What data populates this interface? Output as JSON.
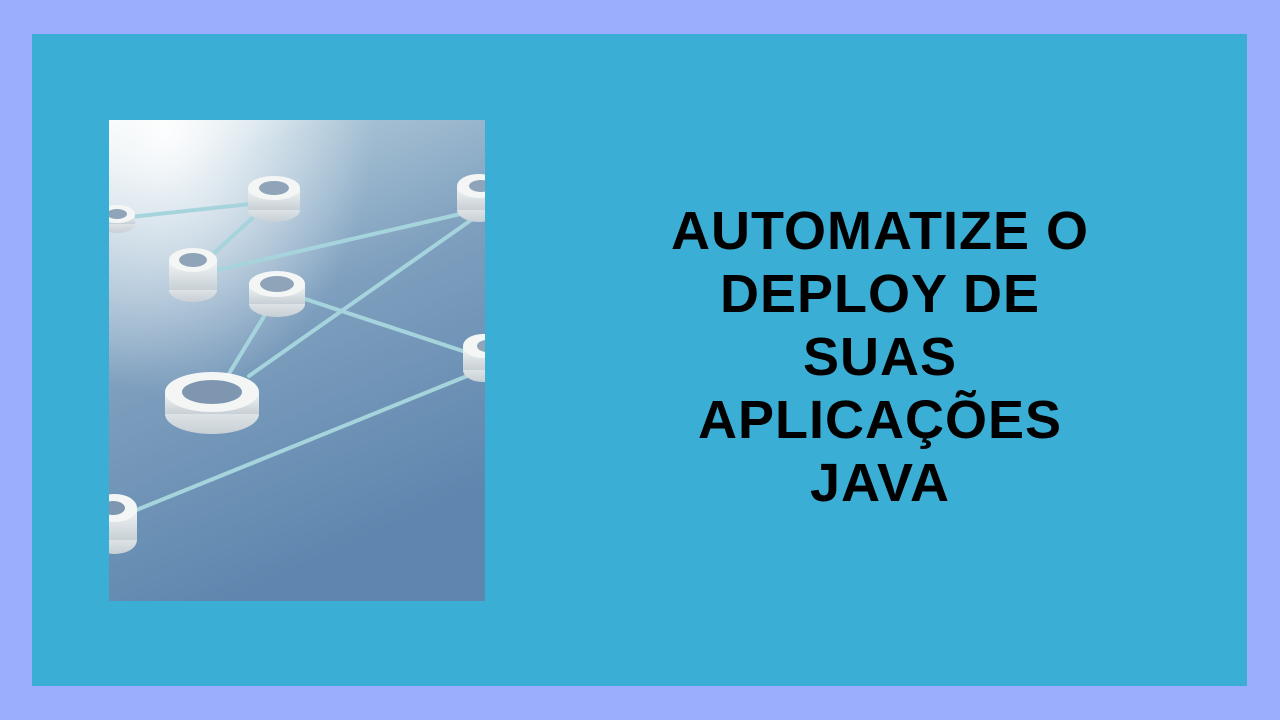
{
  "colors": {
    "border": "#9BAEFE",
    "panel": "#3BAED5",
    "headline_text": "#000000",
    "image_sky": "#E8F3F3",
    "image_floor": "#5E86AE",
    "node_fill": "#EEF1F1",
    "link_color": "#A6D4DD"
  },
  "headline": {
    "line_1": "AUTOMATIZE O",
    "line_2": "DEPLOY DE",
    "line_3": "SUAS",
    "line_4": "APLICAÇÕES",
    "line_5": "JAVA"
  },
  "illustration": {
    "subject": "network-nodes-image"
  }
}
